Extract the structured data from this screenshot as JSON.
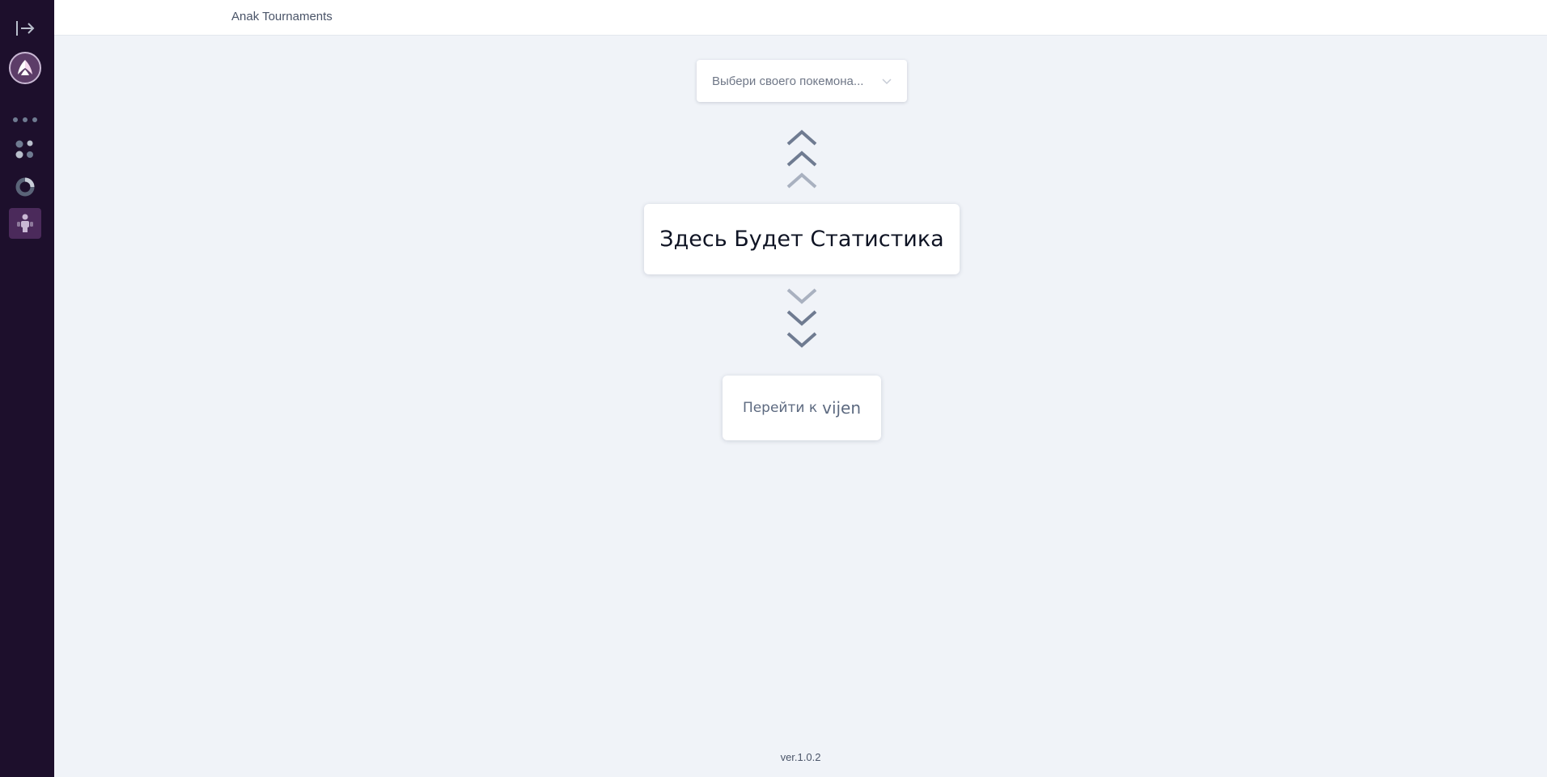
{
  "header": {
    "title": "Anak Tournaments"
  },
  "sidebar": {
    "items": [
      {
        "icon": "collapse-sidebar-icon"
      },
      {
        "icon": "app-logo"
      },
      {
        "icon": "more-dots-icon"
      },
      {
        "icon": "grid-dots-icon"
      },
      {
        "icon": "pie-chart-icon"
      },
      {
        "icon": "people-icon",
        "active": true
      }
    ],
    "active_color": "#4b2a5b",
    "background": "#1d0f2c"
  },
  "main": {
    "select": {
      "placeholder": "Выбери своего покемона..."
    },
    "stat_card": {
      "text": "Здесь Будет Статистика"
    },
    "goto_button": {
      "label": "Перейти к",
      "name": "vijen"
    }
  },
  "footer": {
    "version": "ver.1.0.2"
  },
  "colors": {
    "background": "#f0f3f8",
    "arrow": "#6f7b91",
    "arrow_light": "#a9b1c0"
  }
}
